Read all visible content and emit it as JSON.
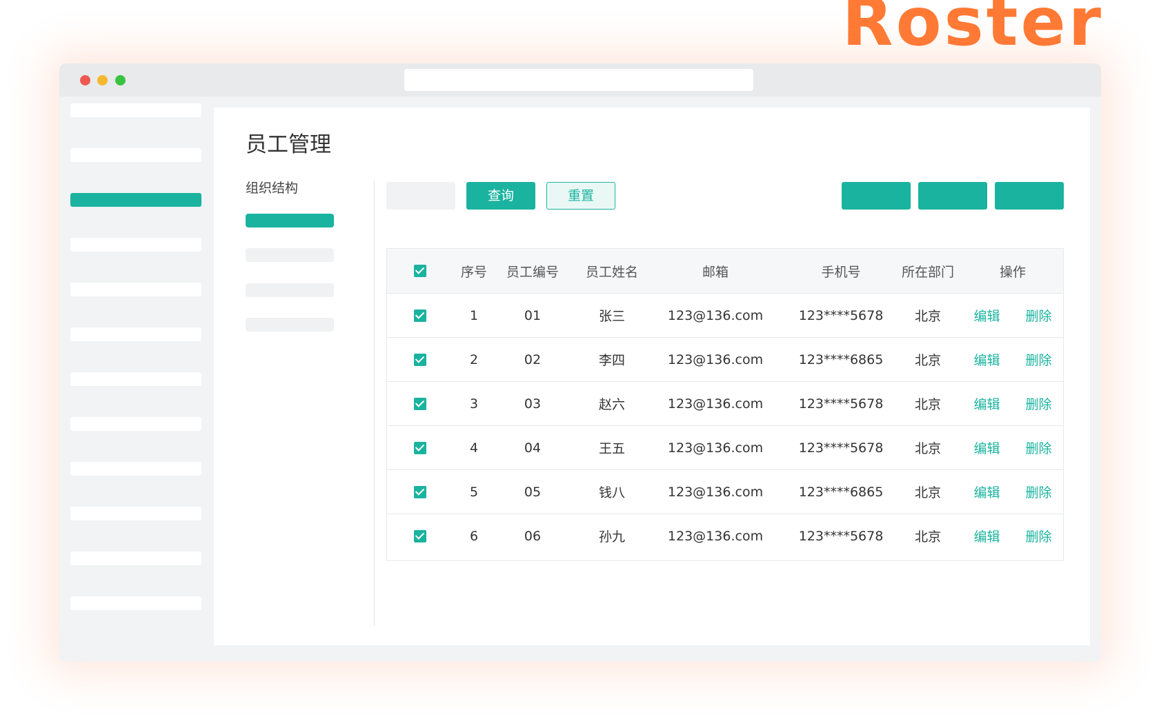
{
  "brand": {
    "logo_text": "Roster",
    "accent": "#1ab39f",
    "logo_color": "#ff7a35"
  },
  "page": {
    "title": "员工管理"
  },
  "org": {
    "title": "组织结构"
  },
  "filters": {
    "query_label": "查询",
    "reset_label": "重置"
  },
  "table": {
    "headers": [
      "序号",
      "员工编号",
      "员工姓名",
      "邮箱",
      "手机号",
      "所在部门",
      "操作"
    ],
    "edit_label": "编辑",
    "delete_label": "删除",
    "rows": [
      {
        "index": "1",
        "id": "01",
        "name": "张三",
        "email": "123@136.com",
        "phone": "123****5678",
        "dept": "北京",
        "checked": true
      },
      {
        "index": "2",
        "id": "02",
        "name": "李四",
        "email": "123@136.com",
        "phone": "123****6865",
        "dept": "北京",
        "checked": true
      },
      {
        "index": "3",
        "id": "03",
        "name": "赵六",
        "email": "123@136.com",
        "phone": "123****5678",
        "dept": "北京",
        "checked": true
      },
      {
        "index": "4",
        "id": "04",
        "name": "王五",
        "email": "123@136.com",
        "phone": "123****5678",
        "dept": "北京",
        "checked": true
      },
      {
        "index": "5",
        "id": "05",
        "name": "钱八",
        "email": "123@136.com",
        "phone": "123****6865",
        "dept": "北京",
        "checked": true
      },
      {
        "index": "6",
        "id": "06",
        "name": "孙九",
        "email": "123@136.com",
        "phone": "123****5678",
        "dept": "北京",
        "checked": true
      }
    ]
  }
}
